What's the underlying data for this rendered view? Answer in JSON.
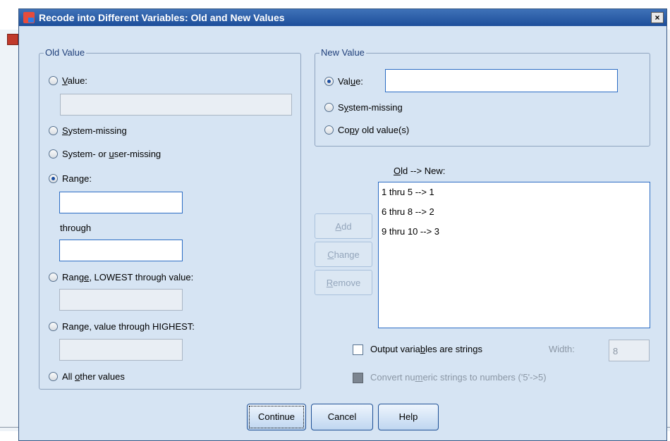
{
  "dialog": {
    "title": "Recode into Different Variables: Old and New Values",
    "close_glyph": "×"
  },
  "old_value": {
    "legend": "Old Value",
    "value": {
      "prefix": "",
      "accel": "V",
      "rest": "alue:"
    },
    "system_missing": {
      "accel": "S",
      "rest": "ystem-missing"
    },
    "sys_or_user": {
      "prefix": "System- or ",
      "accel": "u",
      "rest": "ser-missing"
    },
    "range": {
      "prefix": "Ran",
      "accel": "g",
      "rest": "e:"
    },
    "through": "through",
    "range_lowest": {
      "prefix": "Rang",
      "accel": "e",
      "rest": ", LOWEST through value:"
    },
    "range_highest": {
      "prefix": "Ran",
      "accel": "g",
      "rest": "e, value through HIGHEST:"
    },
    "all_other": {
      "prefix": "All ",
      "accel": "o",
      "rest": "ther values"
    }
  },
  "new_value": {
    "legend": "New Value",
    "value": {
      "prefix": "Val",
      "accel": "u",
      "rest": "e:"
    },
    "system_missing": {
      "prefix": "S",
      "accel": "y",
      "rest": "stem-missing"
    },
    "copy_old": {
      "prefix": "Co",
      "accel": "p",
      "rest": "y old value(s)"
    }
  },
  "mapping": {
    "header_accel": "O",
    "header_rest": "ld --> New:",
    "items": [
      "1 thru 5 --> 1",
      "6 thru 8 --> 2",
      "9 thru 10 --> 3"
    ]
  },
  "side_buttons": {
    "add": {
      "accel": "A",
      "rest": "dd"
    },
    "change": {
      "accel": "C",
      "rest": "hange"
    },
    "remove": {
      "accel": "R",
      "rest": "emove"
    }
  },
  "options": {
    "output_strings": {
      "prefix": "Output varia",
      "accel": "b",
      "rest": "les are strings"
    },
    "width_label": "Width:",
    "width_value": "8",
    "convert": {
      "prefix": "Convert nu",
      "accel": "m",
      "rest": "eric strings to numbers ('5'->5)"
    }
  },
  "buttons": {
    "continue": "Continue",
    "cancel": "Cancel",
    "help": "Help"
  },
  "colors": {
    "titlebar": "#1d4e9a",
    "dialog_bg": "#d6e4f3"
  }
}
